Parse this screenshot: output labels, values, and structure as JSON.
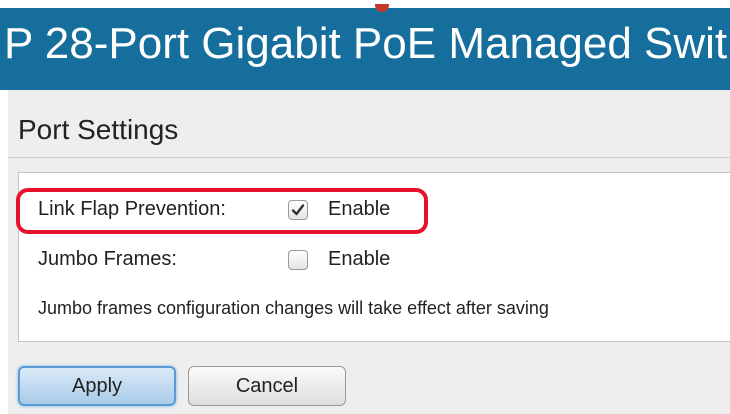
{
  "header": {
    "title": "P 28-Port Gigabit PoE Managed Swit"
  },
  "page": {
    "title": "Port Settings"
  },
  "fields": {
    "link_flap": {
      "label": "Link Flap Prevention:",
      "checkbox_label": "Enable",
      "checked": true
    },
    "jumbo_frames": {
      "label": "Jumbo Frames:",
      "checkbox_label": "Enable",
      "checked": false
    }
  },
  "note": "Jumbo frames configuration changes will take effect after saving",
  "buttons": {
    "apply": "Apply",
    "cancel": "Cancel"
  },
  "colors": {
    "header_bg": "#166e9c",
    "highlight": "#e8112d",
    "content_bg": "#eeeeee"
  }
}
